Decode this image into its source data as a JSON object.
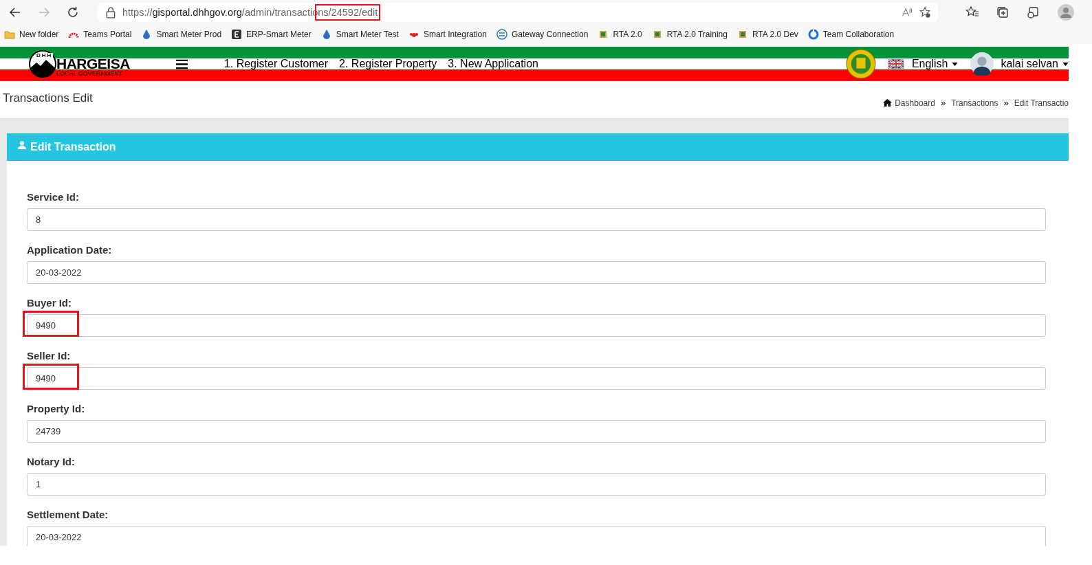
{
  "browser": {
    "url": [
      {
        "text": "https://",
        "kind": "scheme",
        "highlighted": false
      },
      {
        "text": "gisportal.dhhgov.org",
        "kind": "host",
        "highlighted": false
      },
      {
        "text": "/admin/transactio",
        "kind": "path",
        "highlighted": false
      },
      {
        "text": "ns/24592/edit",
        "kind": "path",
        "highlighted": true
      }
    ],
    "bookmarks": [
      {
        "label": "New folder"
      },
      {
        "label": "Teams Portal"
      },
      {
        "label": "Smart Meter Prod"
      },
      {
        "label": "ERP-Smart Meter"
      },
      {
        "label": "Smart Meter Test"
      },
      {
        "label": "Smart Integration"
      },
      {
        "label": "Gateway Connection"
      },
      {
        "label": "RTA 2.0"
      },
      {
        "label": "RTA 2.0 Training"
      },
      {
        "label": "RTA 2.0 Dev"
      },
      {
        "label": "Team Collaboration"
      }
    ]
  },
  "header": {
    "logo_title": "HARGEISA",
    "logo_subtitle": "LOCAL GOVERNMENT",
    "logo_letters": "DHH",
    "nav": [
      "1. Register Customer",
      "2. Register Property",
      "3. New Application"
    ],
    "language": "English",
    "user": "kalai selvan"
  },
  "page": {
    "title": "Transactions Edit",
    "breadcrumb": [
      "Dashboard",
      "Transactions",
      "Edit Transactio"
    ],
    "separator": "»"
  },
  "card": {
    "title": "Edit Transaction",
    "fields": [
      {
        "label": "Service Id:",
        "value": "8",
        "highlighted": false
      },
      {
        "label": "Application Date:",
        "value": "20-03-2022",
        "highlighted": false
      },
      {
        "label": "Buyer Id:",
        "value": "9490",
        "highlighted": true
      },
      {
        "label": "Seller Id:",
        "value": "9490",
        "highlighted": true
      },
      {
        "label": "Property Id:",
        "value": "24739",
        "highlighted": false
      },
      {
        "label": "Notary Id:",
        "value": "1",
        "highlighted": false
      },
      {
        "label": "Settlement Date:",
        "value": "20-03-2022",
        "highlighted": false
      }
    ]
  }
}
